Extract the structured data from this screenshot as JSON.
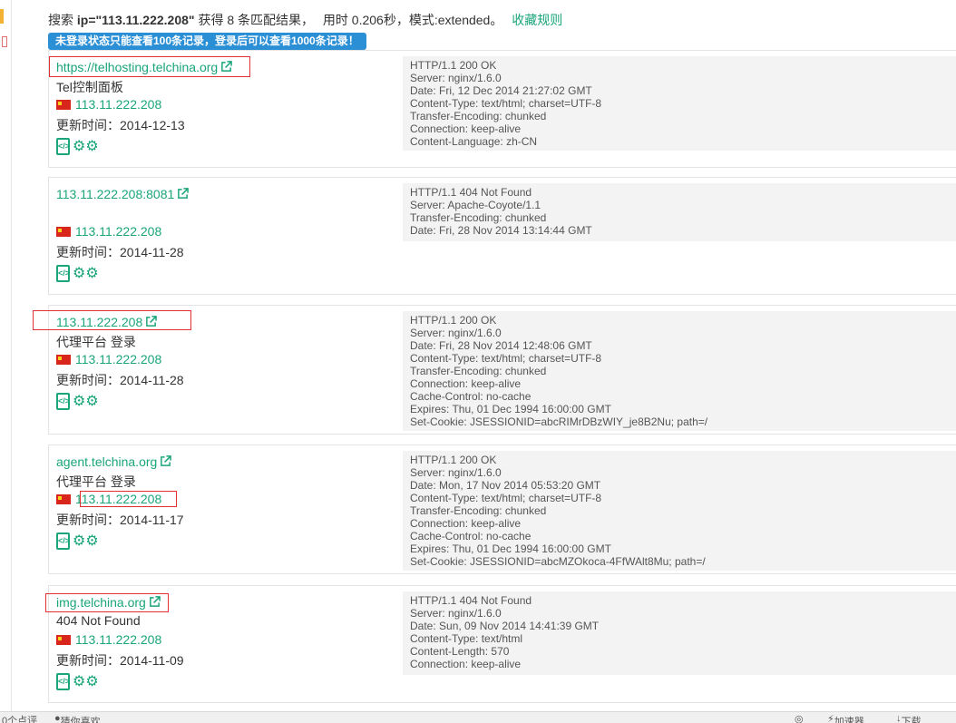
{
  "search": {
    "prefix": "搜索",
    "query": "ip=\"113.11.222.208\"",
    "mid": "获得",
    "count": "8",
    "suffix": "条匹配结果，",
    "time": "用时 0.206秒，模式:extended。",
    "favorite": "收藏规则"
  },
  "notice": "未登录状态只能查看100条记录，登录后可以查看1000条记录！",
  "update_label": "更新时间：",
  "results": [
    {
      "link": "https://telhosting.telchina.org",
      "title": "Tel控制面板",
      "ip": "113.11.222.208",
      "updated": "2014-12-13",
      "banner": "HTTP/1.1 200 OK\nServer: nginx/1.6.0\nDate: Fri, 12 Dec 2014 21:27:02 GMT\nContent-Type: text/html; charset=UTF-8\nTransfer-Encoding: chunked\nConnection: keep-alive\nContent-Language: zh-CN"
    },
    {
      "link": "113.11.222.208:8081",
      "title": "",
      "ip": "113.11.222.208",
      "updated": "2014-11-28",
      "banner": "HTTP/1.1 404 Not Found\nServer: Apache-Coyote/1.1\nTransfer-Encoding: chunked\nDate: Fri, 28 Nov 2014 13:14:44 GMT"
    },
    {
      "link": "113.11.222.208",
      "title": "代理平台 登录",
      "ip": "113.11.222.208",
      "updated": "2014-11-28",
      "banner": "HTTP/1.1 200 OK\nServer: nginx/1.6.0\nDate: Fri, 28 Nov 2014 12:48:06 GMT\nContent-Type: text/html; charset=UTF-8\nTransfer-Encoding: chunked\nConnection: keep-alive\nCache-Control: no-cache\nExpires: Thu, 01 Dec 1994 16:00:00 GMT\nSet-Cookie: JSESSIONID=abcRIMrDBzWIY_je8B2Nu; path=/"
    },
    {
      "link": "agent.telchina.org",
      "title": "代理平台 登录",
      "ip": "113.11.222.208",
      "updated": "2014-11-17",
      "banner": "HTTP/1.1 200 OK\nServer: nginx/1.6.0\nDate: Mon, 17 Nov 2014 05:53:20 GMT\nContent-Type: text/html; charset=UTF-8\nTransfer-Encoding: chunked\nConnection: keep-alive\nCache-Control: no-cache\nExpires: Thu, 01 Dec 1994 16:00:00 GMT\nSet-Cookie: JSESSIONID=abcMZOkoca-4FfWAlt8Mu; path=/"
    },
    {
      "link": "img.telchina.org",
      "title": "404 Not Found",
      "ip": "113.11.222.208",
      "updated": "2014-11-09",
      "banner": "HTTP/1.1 404 Not Found\nServer: nginx/1.6.0\nDate: Sun, 09 Nov 2014 14:41:39 GMT\nContent-Type: text/html\nContent-Length: 570\nConnection: keep-alive"
    }
  ],
  "bottombar": {
    "left": "0个点评",
    "guess": "猜你喜欢",
    "accelerator": "加速器",
    "download": "下载"
  },
  "colors": {
    "accent": "#1aa57a",
    "notice_bg": "#2b8fd6",
    "highlight": "#e03030"
  }
}
